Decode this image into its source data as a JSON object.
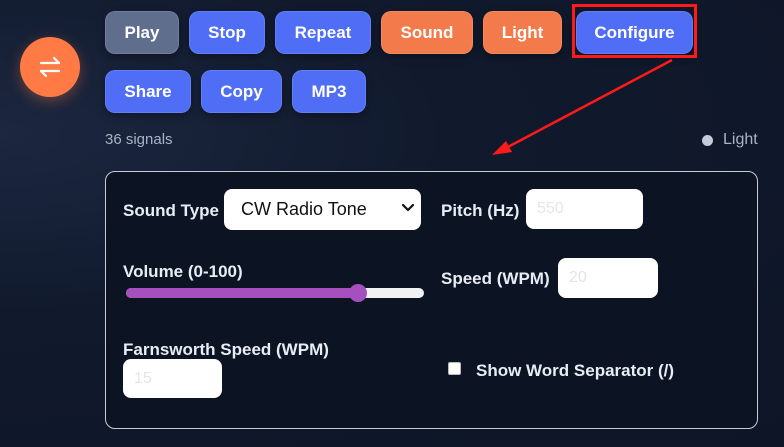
{
  "fab": {
    "icon": "swap-arrows-icon",
    "color": "#ff7a45"
  },
  "toolbar": {
    "play": "Play",
    "stop": "Stop",
    "repeat": "Repeat",
    "sound": "Sound",
    "light": "Light",
    "configure": "Configure",
    "share": "Share",
    "copy": "Copy",
    "mp3": "MP3"
  },
  "status": {
    "signals": "36 signals",
    "theme_label": "Light"
  },
  "config": {
    "sound_type_label": "Sound Type",
    "sound_type_value": "CW Radio Tone",
    "pitch_label": "Pitch (Hz)",
    "pitch_value": "550",
    "volume_label": "Volume (0-100)",
    "volume_value": 0.78,
    "speed_label": "Speed (WPM)",
    "speed_value": "20",
    "farnsworth_label": "Farnsworth Speed (WPM)",
    "farnsworth_value": "15",
    "word_separator_label": "Show Word Separator (/)",
    "word_separator_checked": false
  },
  "colors": {
    "accent_blue": "#4f6df5",
    "accent_orange": "#f27a4b",
    "muted_gray": "#5e6e8c",
    "slider_purple": "#a64fbf",
    "annotation_red": "#ff1a1a"
  }
}
